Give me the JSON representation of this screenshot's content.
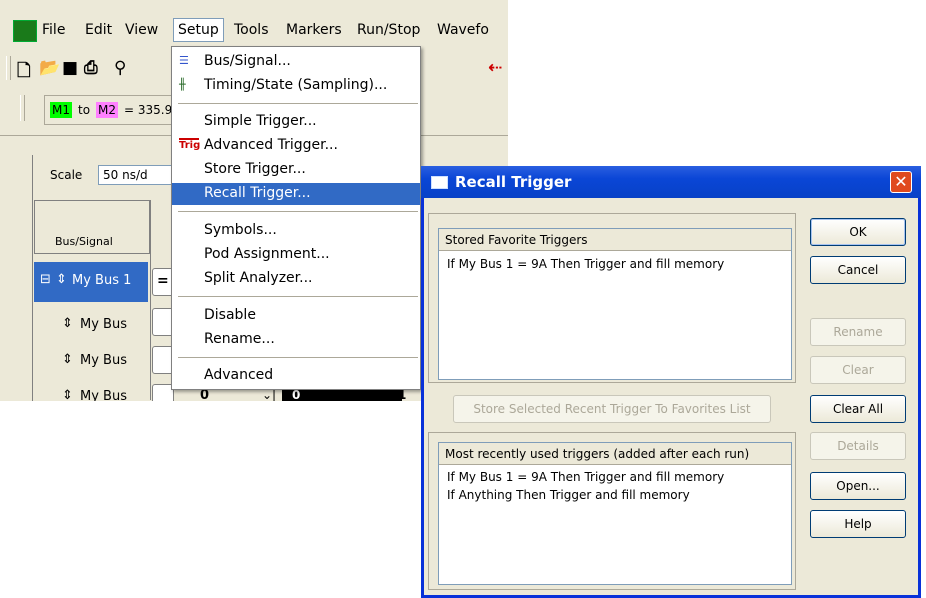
{
  "menubar": {
    "items": [
      "File",
      "Edit",
      "View",
      "Setup",
      "Tools",
      "Markers",
      "Run/Stop",
      "Wavefo"
    ]
  },
  "markers": {
    "m1": "M1",
    "to": "to",
    "m2": "M2",
    "value": "= 335.9"
  },
  "waveform": {
    "scale_label": "Scale",
    "scale_value": "50 ns/d",
    "bus_signal_header": "Bus/Signal",
    "rows": [
      "My Bus 1",
      "My Bus",
      "My Bus",
      "My Bus"
    ],
    "selected_value": "=",
    "partial_value": "0",
    "partial_value2": "0",
    "partial_value3": "1"
  },
  "setup_menu": {
    "items": [
      {
        "label": "Bus/Signal...",
        "icon": "bus-signal-icon"
      },
      {
        "label": "Timing/State (Sampling)...",
        "icon": "timing-icon"
      },
      {
        "label": "Simple Trigger..."
      },
      {
        "label": "Advanced Trigger...",
        "icon": "advanced-trigger-icon",
        "icon_text": "Trig"
      },
      {
        "label": "Store Trigger..."
      },
      {
        "label": "Recall Trigger...",
        "highlighted": true
      },
      {
        "label": "Symbols..."
      },
      {
        "label": "Pod Assignment..."
      },
      {
        "label": "Split Analyzer..."
      },
      {
        "label": "Disable"
      },
      {
        "label": "Rename..."
      },
      {
        "label": "Advanced"
      }
    ]
  },
  "dialog": {
    "title": "Recall Trigger",
    "favorites_header": "Stored Favorite Triggers",
    "favorites": [
      "If My Bus 1 = 9A Then Trigger and fill memory"
    ],
    "store_selected_label": "Store Selected Recent Trigger To Favorites List",
    "recent_header": "Most recently used triggers (added after each run)",
    "recent": [
      "If My Bus 1 = 9A Then Trigger and fill memory",
      "If Anything Then Trigger and fill memory"
    ],
    "buttons": {
      "ok": "OK",
      "cancel": "Cancel",
      "rename": "Rename",
      "clear": "Clear",
      "clear_all": "Clear All",
      "details": "Details",
      "open": "Open...",
      "help": "Help"
    }
  },
  "colors": {
    "titlebar": "#0a46d6",
    "selection": "#316ac5",
    "marker1": "#00ff00",
    "marker2": "#ff80ff",
    "close": "#e04a1e"
  }
}
